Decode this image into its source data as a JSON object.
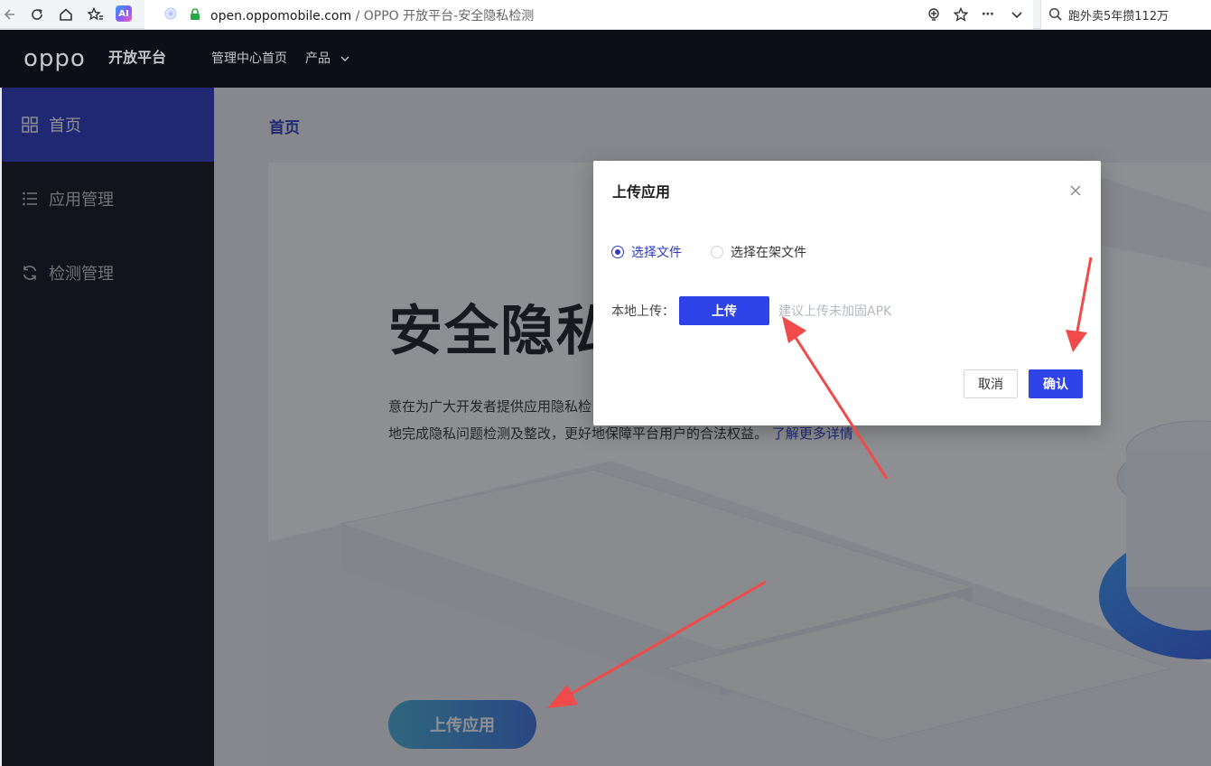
{
  "browser": {
    "url_domain": "open.oppomobile.com",
    "url_separator": " / ",
    "page_title": "OPPO 开放平台-安全隐私检测",
    "ai_badge": "AI",
    "search_text": "跑外卖5年攒112万"
  },
  "header": {
    "logo": "oppo",
    "logo_sub": "开放平台",
    "nav_home": "管理中心首页",
    "nav_products": "产品"
  },
  "sidebar": {
    "items": [
      {
        "label": "首页",
        "icon": "grid-icon",
        "active": true
      },
      {
        "label": "应用管理",
        "icon": "list-icon",
        "active": false
      },
      {
        "label": "检测管理",
        "icon": "refresh-icon",
        "active": false
      }
    ]
  },
  "main": {
    "breadcrumb": "首页",
    "hero_title": "安全隐私",
    "hero_desc_line1": "意在为广大开发者提供应用隐私检",
    "hero_desc_line2": "地完成隐私问题检测及整改，更好地保障平台用户的合法权益。",
    "hero_link": "了解更多详情",
    "upload_app_button": "上传应用"
  },
  "modal": {
    "title": "上传应用",
    "radio_selected": "选择文件",
    "radio_other": "选择在架文件",
    "upload_label": "本地上传：",
    "upload_button": "上传",
    "upload_hint": "建议上传未加固APK",
    "cancel": "取消",
    "confirm": "确认"
  },
  "colors": {
    "brand_blue": "#2e44e8",
    "sidebar_active": "#2c3bc6",
    "annotation_red": "#f04a4a"
  }
}
